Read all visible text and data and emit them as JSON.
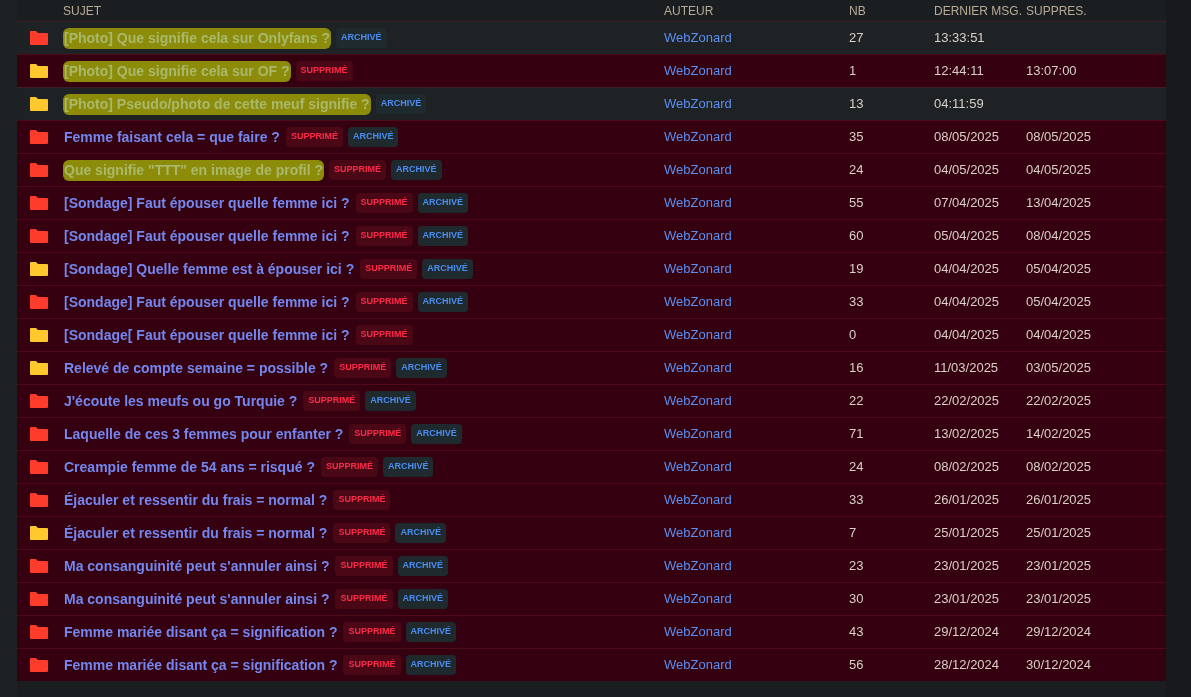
{
  "table": {
    "columns": [
      "SUJET",
      "AUTEUR",
      "NB",
      "DERNIER MSG.",
      "SUPPRES."
    ],
    "rows": [
      {
        "deleted": false,
        "color": "#ff3b2b",
        "title": "[Photo] Que signifie cela sur Onlyfans ?",
        "highlighted": true,
        "badges": [
          {
            "kind": "archived",
            "label": "ARCHIVÉ"
          }
        ],
        "author": "WebZonard",
        "count": "27",
        "last_message": "13:33:51"
      },
      {
        "deleted": true,
        "color": "#ffc82c",
        "title": "[Photo] Que signifie cela sur OF ?",
        "highlighted": true,
        "badges": [
          {
            "kind": "deleted",
            "label": "SUPPRIMÉ"
          }
        ],
        "author": "WebZonard",
        "count": "1",
        "last_message": "12:44:11",
        "deleted_at": "13:07:00"
      },
      {
        "deleted": false,
        "color": "#ffc82c",
        "title": "[Photo] Pseudo/photo de cette meuf signifie ?",
        "highlighted": true,
        "badges": [
          {
            "kind": "archived",
            "label": "ARCHIVÉ"
          }
        ],
        "author": "WebZonard",
        "count": "13",
        "last_message": "04:11:59"
      },
      {
        "deleted": true,
        "color": "#ff3b2b",
        "title": "Femme faisant cela = que faire ?",
        "highlighted": false,
        "badges": [
          {
            "kind": "deleted",
            "label": "SUPPRIMÉ"
          },
          {
            "kind": "archived",
            "label": "ARCHIVÉ"
          }
        ],
        "author": "WebZonard",
        "count": "35",
        "last_message": "08/05/2025",
        "deleted_at": "08/05/2025"
      },
      {
        "deleted": true,
        "color": "#ff3b2b",
        "title": "Que signifie \"TTT\" en image de profil ?",
        "highlighted": true,
        "badges": [
          {
            "kind": "deleted",
            "label": "SUPPRIMÉ"
          },
          {
            "kind": "archived",
            "label": "ARCHIVÉ"
          }
        ],
        "author": "WebZonard",
        "count": "24",
        "last_message": "04/05/2025",
        "deleted_at": "04/05/2025"
      },
      {
        "deleted": true,
        "color": "#ff3b2b",
        "title": "[Sondage] Faut épouser quelle femme ici ?",
        "highlighted": false,
        "badges": [
          {
            "kind": "deleted",
            "label": "SUPPRIMÉ"
          },
          {
            "kind": "archived",
            "label": "ARCHIVÉ"
          }
        ],
        "author": "WebZonard",
        "count": "55",
        "last_message": "07/04/2025",
        "deleted_at": "13/04/2025"
      },
      {
        "deleted": true,
        "color": "#ff3b2b",
        "title": "[Sondage] Faut épouser quelle femme ici ?",
        "highlighted": false,
        "badges": [
          {
            "kind": "deleted",
            "label": "SUPPRIMÉ"
          },
          {
            "kind": "archived",
            "label": "ARCHIVÉ"
          }
        ],
        "author": "WebZonard",
        "count": "60",
        "last_message": "05/04/2025",
        "deleted_at": "08/04/2025"
      },
      {
        "deleted": true,
        "color": "#ffc82c",
        "title": "[Sondage] Quelle femme est à épouser ici ?",
        "highlighted": false,
        "badges": [
          {
            "kind": "deleted",
            "label": "SUPPRIMÉ"
          },
          {
            "kind": "archived",
            "label": "ARCHIVÉ"
          }
        ],
        "author": "WebZonard",
        "count": "19",
        "last_message": "04/04/2025",
        "deleted_at": "05/04/2025"
      },
      {
        "deleted": true,
        "color": "#ff3b2b",
        "title": "[Sondage] Faut épouser quelle femme ici ?",
        "highlighted": false,
        "badges": [
          {
            "kind": "deleted",
            "label": "SUPPRIMÉ"
          },
          {
            "kind": "archived",
            "label": "ARCHIVÉ"
          }
        ],
        "author": "WebZonard",
        "count": "33",
        "last_message": "04/04/2025",
        "deleted_at": "05/04/2025"
      },
      {
        "deleted": true,
        "color": "#ffc82c",
        "title": "[Sondage[ Faut épouser quelle femme ici ?",
        "highlighted": false,
        "badges": [
          {
            "kind": "deleted",
            "label": "SUPPRIMÉ"
          }
        ],
        "author": "WebZonard",
        "count": "0",
        "last_message": "04/04/2025",
        "deleted_at": "04/04/2025"
      },
      {
        "deleted": true,
        "color": "#ffc82c",
        "title": "Relevé de compte semaine = possible ?",
        "highlighted": false,
        "badges": [
          {
            "kind": "deleted",
            "label": "SUPPRIMÉ"
          },
          {
            "kind": "archived",
            "label": "ARCHIVÉ"
          }
        ],
        "author": "WebZonard",
        "count": "16",
        "last_message": "11/03/2025",
        "deleted_at": "03/05/2025"
      },
      {
        "deleted": true,
        "color": "#ff3b2b",
        "title": "J'écoute les meufs ou go Turquie ?",
        "highlighted": false,
        "badges": [
          {
            "kind": "deleted",
            "label": "SUPPRIMÉ"
          },
          {
            "kind": "archived",
            "label": "ARCHIVÉ"
          }
        ],
        "author": "WebZonard",
        "count": "22",
        "last_message": "22/02/2025",
        "deleted_at": "22/02/2025"
      },
      {
        "deleted": true,
        "color": "#ff3b2b",
        "title": "Laquelle de ces 3 femmes pour enfanter ?",
        "highlighted": false,
        "badges": [
          {
            "kind": "deleted",
            "label": "SUPPRIMÉ"
          },
          {
            "kind": "archived",
            "label": "ARCHIVÉ"
          }
        ],
        "author": "WebZonard",
        "count": "71",
        "last_message": "13/02/2025",
        "deleted_at": "14/02/2025"
      },
      {
        "deleted": true,
        "color": "#ff3b2b",
        "title": "Creampie femme de 54 ans = risqué ?",
        "highlighted": false,
        "badges": [
          {
            "kind": "deleted",
            "label": "SUPPRIMÉ"
          },
          {
            "kind": "archived",
            "label": "ARCHIVÉ"
          }
        ],
        "author": "WebZonard",
        "count": "24",
        "last_message": "08/02/2025",
        "deleted_at": "08/02/2025"
      },
      {
        "deleted": true,
        "color": "#ff3b2b",
        "title": "Éjaculer et ressentir du frais = normal ?",
        "highlighted": false,
        "badges": [
          {
            "kind": "deleted",
            "label": "SUPPRIMÉ"
          }
        ],
        "author": "WebZonard",
        "count": "33",
        "last_message": "26/01/2025",
        "deleted_at": "26/01/2025"
      },
      {
        "deleted": true,
        "color": "#ffc82c",
        "title": "Éjaculer et ressentir du frais = normal ?",
        "highlighted": false,
        "badges": [
          {
            "kind": "deleted",
            "label": "SUPPRIMÉ"
          },
          {
            "kind": "archived",
            "label": "ARCHIVÉ"
          }
        ],
        "author": "WebZonard",
        "count": "7",
        "last_message": "25/01/2025",
        "deleted_at": "25/01/2025"
      },
      {
        "deleted": true,
        "color": "#ff3b2b",
        "title": "Ma consanguinité peut s'annuler ainsi ?",
        "highlighted": false,
        "badges": [
          {
            "kind": "deleted",
            "label": "SUPPRIMÉ"
          },
          {
            "kind": "archived",
            "label": "ARCHIVÉ"
          }
        ],
        "author": "WebZonard",
        "count": "23",
        "last_message": "23/01/2025",
        "deleted_at": "23/01/2025"
      },
      {
        "deleted": true,
        "color": "#ff3b2b",
        "title": "Ma consanguinité peut s'annuler ainsi ?",
        "highlighted": false,
        "badges": [
          {
            "kind": "deleted",
            "label": "SUPPRIMÉ"
          },
          {
            "kind": "archived",
            "label": "ARCHIVÉ"
          }
        ],
        "author": "WebZonard",
        "count": "30",
        "last_message": "23/01/2025",
        "deleted_at": "23/01/2025"
      },
      {
        "deleted": true,
        "color": "#ff3b2b",
        "title": "Femme mariée disant ça = signification ?",
        "highlighted": false,
        "badges": [
          {
            "kind": "deleted",
            "label": "SUPPRIMÉ"
          },
          {
            "kind": "archived",
            "label": "ARCHIVÉ"
          }
        ],
        "author": "WebZonard",
        "count": "43",
        "last_message": "29/12/2024",
        "deleted_at": "29/12/2024"
      },
      {
        "deleted": true,
        "color": "#ff3b2b",
        "title": "Femme mariée disant ça = signification ?",
        "highlighted": false,
        "badges": [
          {
            "kind": "deleted",
            "label": "SUPPRIMÉ"
          },
          {
            "kind": "archived",
            "label": "ARCHIVÉ"
          }
        ],
        "author": "WebZonard",
        "count": "56",
        "last_message": "28/12/2024",
        "deleted_at": "30/12/2024"
      }
    ]
  }
}
